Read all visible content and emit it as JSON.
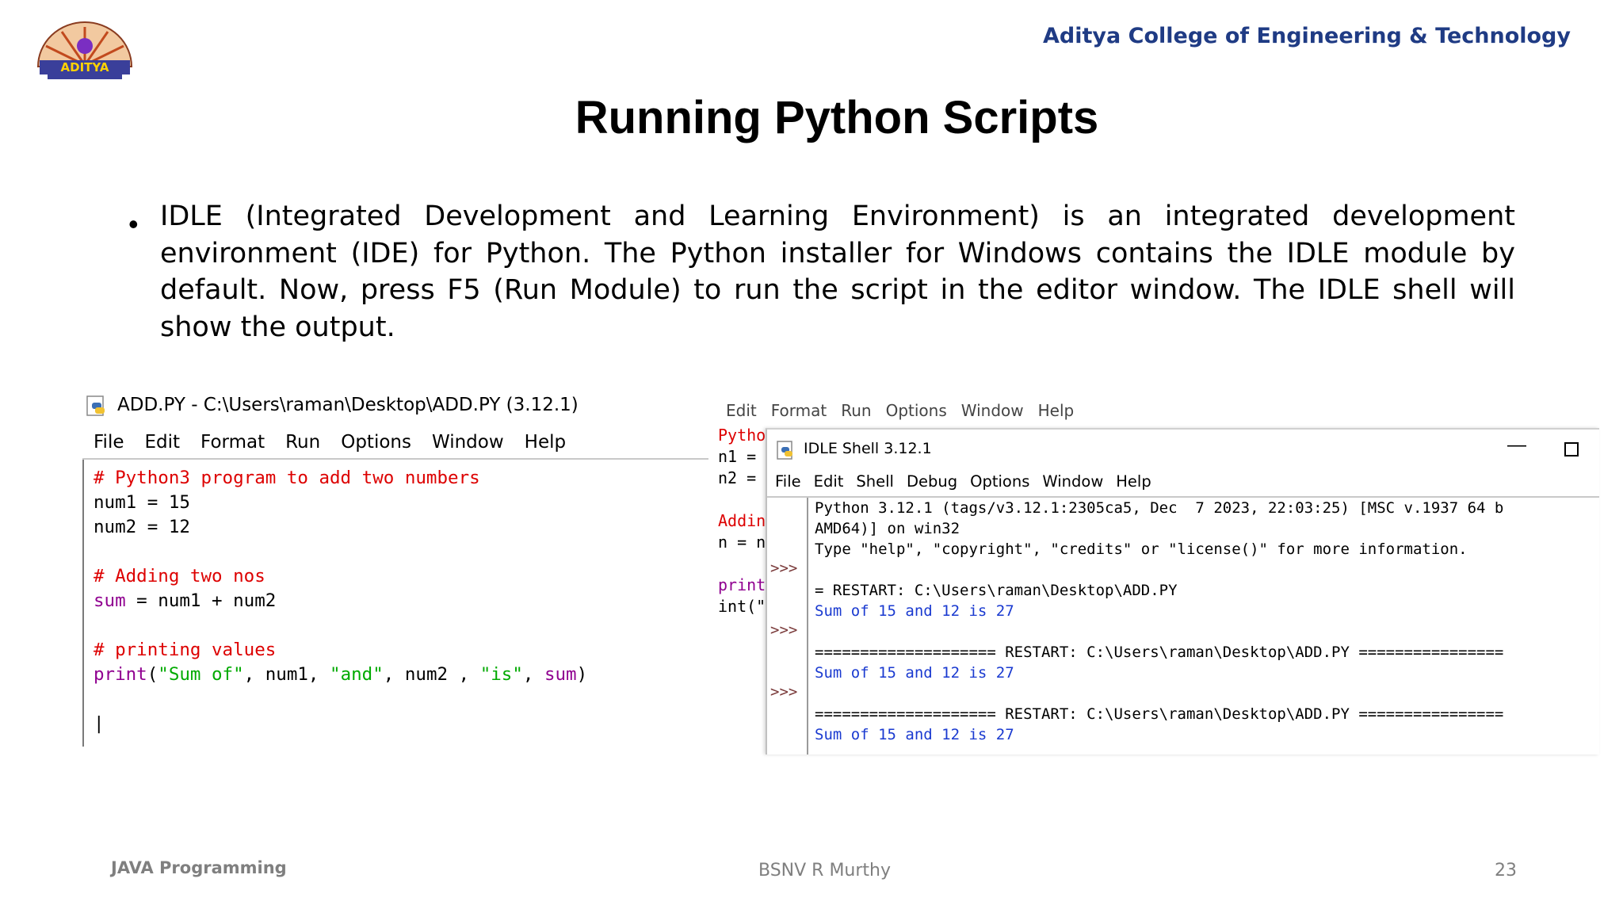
{
  "header": {
    "college": "Aditya College of Engineering & Technology",
    "logo_text": "ADITYA",
    "title": "Running Python Scripts"
  },
  "bullet": "IDLE (Integrated Development and Learning Environment) is an integrated development environment (IDE) for Python. The Python installer for Windows contains the IDLE module by default. Now, press F5 (Run Module) to run the script in the editor window. The IDLE shell will show the output.",
  "editor": {
    "title": "ADD.PY - C:\\Users\\raman\\Desktop\\ADD.PY (3.12.1)",
    "menu": [
      "File",
      "Edit",
      "Format",
      "Run",
      "Options",
      "Window",
      "Help"
    ],
    "code": {
      "line1": "# Python3 program to add two numbers",
      "line2": "num1 = 15",
      "line3": "num2 = 12",
      "line5": "# Adding two nos",
      "line6_kw": "sum",
      "line6_rest": " = num1 + num2",
      "line8": "# printing values",
      "line9_kw": "print",
      "line9_a": "(",
      "line9_s1": "\"Sum of\"",
      "line9_b": ", num1, ",
      "line9_s2": "\"and\"",
      "line9_c": ", num2 , ",
      "line9_s3": "\"is\"",
      "line9_d": ", ",
      "line9_kw2": "sum",
      "line9_e": ")"
    }
  },
  "back_editor": {
    "menu": [
      "Edit",
      "Format",
      "Run",
      "Options",
      "Window",
      "Help"
    ],
    "lines": [
      "Pytho",
      "n1 =",
      "n2 =",
      "",
      "Addin",
      "n = n",
      "",
      "print",
      "int(\""
    ]
  },
  "shell": {
    "title": "IDLE Shell 3.12.1",
    "menu": [
      "File",
      "Edit",
      "Shell",
      "Debug",
      "Options",
      "Window",
      "Help"
    ],
    "prompt": ">>>",
    "lines": {
      "l1": "Python 3.12.1 (tags/v3.12.1:2305ca5, Dec  7 2023, 22:03:25) [MSC v.1937 64 b",
      "l2": "AMD64)] on win32",
      "l3": "Type \"help\", \"copyright\", \"credits\" or \"license()\" for more information.",
      "l4": "= RESTART: C:\\Users\\raman\\Desktop\\ADD.PY",
      "l5": "Sum of 15 and 12 is 27",
      "l6": "==================== RESTART: C:\\Users\\raman\\Desktop\\ADD.PY ================",
      "l7": "Sum of 15 and 12 is 27",
      "l8": "==================== RESTART: C:\\Users\\raman\\Desktop\\ADD.PY ================",
      "l9": "Sum of 15 and 12 is 27"
    }
  },
  "footer": {
    "left": "JAVA Programming",
    "center": "BSNV R Murthy",
    "page": "23"
  }
}
